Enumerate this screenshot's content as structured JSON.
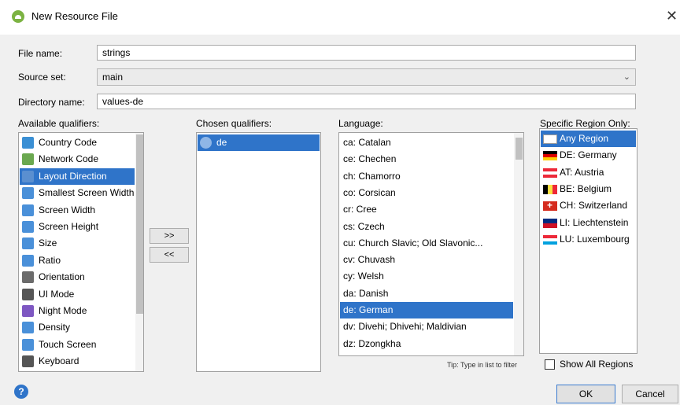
{
  "window": {
    "title": "New Resource File"
  },
  "form": {
    "file_name_label": "File name:",
    "file_name_value": "strings",
    "source_set_label": "Source set:",
    "source_set_value": "main",
    "directory_label": "Directory name:",
    "directory_value": "values-de"
  },
  "available": {
    "label": "Available qualifiers:",
    "items": [
      {
        "label": "Country Code",
        "icon": "country-code-icon",
        "color": "#3a8fd4"
      },
      {
        "label": "Network Code",
        "icon": "network-code-icon",
        "color": "#6aa84f"
      },
      {
        "label": "Layout Direction",
        "icon": "layout-direction-icon",
        "color": "#5a8fd0",
        "selected": true
      },
      {
        "label": "Smallest Screen Width",
        "icon": "smallest-screen-width-icon",
        "color": "#4a90d9"
      },
      {
        "label": "Screen Width",
        "icon": "screen-width-icon",
        "color": "#4a90d9"
      },
      {
        "label": "Screen Height",
        "icon": "screen-height-icon",
        "color": "#4a90d9"
      },
      {
        "label": "Size",
        "icon": "size-icon",
        "color": "#4a90d9"
      },
      {
        "label": "Ratio",
        "icon": "ratio-icon",
        "color": "#4a90d9"
      },
      {
        "label": "Orientation",
        "icon": "orientation-icon",
        "color": "#6b6b6b"
      },
      {
        "label": "UI Mode",
        "icon": "ui-mode-icon",
        "color": "#555555"
      },
      {
        "label": "Night Mode",
        "icon": "night-mode-icon",
        "color": "#7e57c2"
      },
      {
        "label": "Density",
        "icon": "density-icon",
        "color": "#4a90d9"
      },
      {
        "label": "Touch Screen",
        "icon": "touch-screen-icon",
        "color": "#4a90d9"
      },
      {
        "label": "Keyboard",
        "icon": "keyboard-icon",
        "color": "#555555"
      }
    ]
  },
  "chosen": {
    "label": "Chosen qualifiers:",
    "items": [
      {
        "label": "de",
        "icon": "globe-icon"
      }
    ]
  },
  "buttons": {
    "add": ">>",
    "remove": "<<",
    "ok": "OK",
    "cancel": "Cancel"
  },
  "language": {
    "label": "Language:",
    "items": [
      "ca: Catalan",
      "ce: Chechen",
      "ch: Chamorro",
      "co: Corsican",
      "cr: Cree",
      "cs: Czech",
      "cu: Church Slavic; Old Slavonic...",
      "cv: Chuvash",
      "cy: Welsh",
      "da: Danish",
      "de: German",
      "dv: Divehi; Dhivehi; Maldivian",
      "dz: Dzongkha"
    ],
    "selected_index": 10,
    "tip": "Tip: Type in list to filter"
  },
  "region": {
    "label": "Specific Region Only:",
    "items": [
      {
        "label": "Any Region",
        "flag": "any"
      },
      {
        "label": "DE: Germany",
        "flag": "de"
      },
      {
        "label": "AT: Austria",
        "flag": "at"
      },
      {
        "label": "BE: Belgium",
        "flag": "be"
      },
      {
        "label": "CH: Switzerland",
        "flag": "ch"
      },
      {
        "label": "LI: Liechtenstein",
        "flag": "li"
      },
      {
        "label": "LU: Luxembourg",
        "flag": "lu"
      }
    ],
    "selected_index": 0,
    "show_all_label": "Show All Regions",
    "show_all_checked": false
  },
  "colors": {
    "accent": "#2f74c9"
  }
}
